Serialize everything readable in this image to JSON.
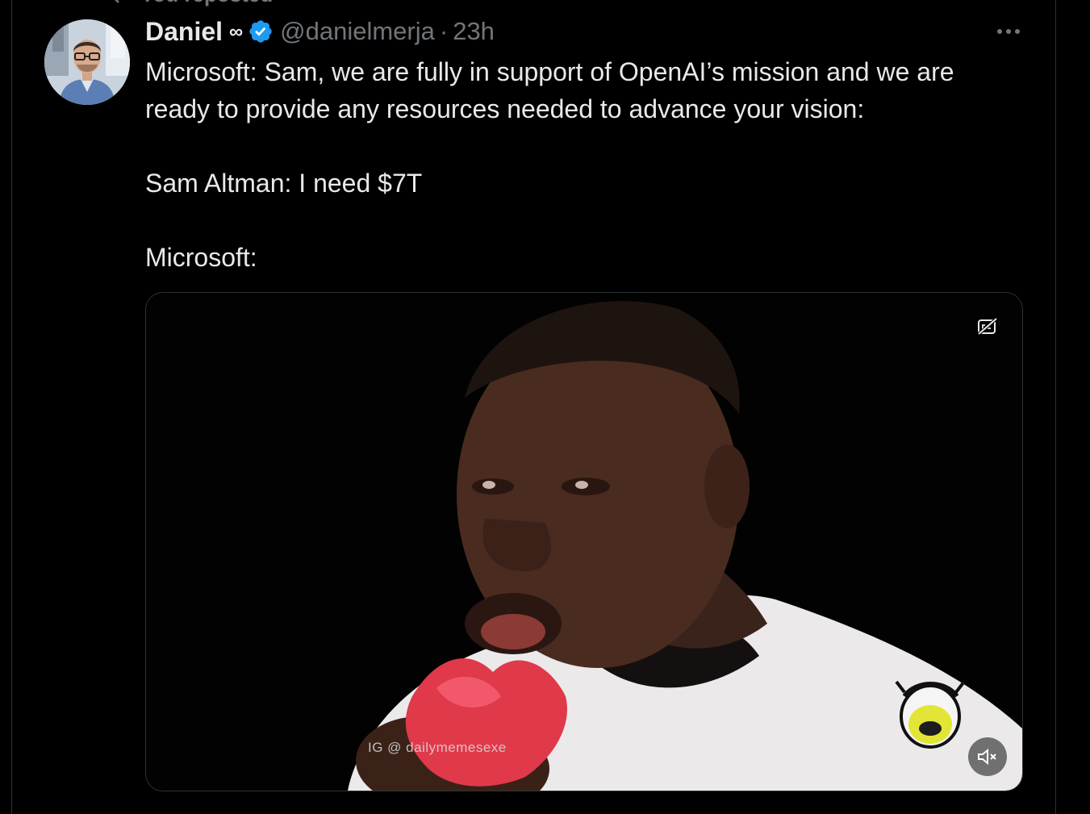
{
  "repost": {
    "label": "You reposted"
  },
  "author": {
    "name": "Daniel",
    "affiliation_icon": "∞",
    "handle": "@danielmerja",
    "separator": "·",
    "time": "23h"
  },
  "tweet": {
    "line1": "Microsoft: Sam, we are fully in support of OpenAI’s mission and we are",
    "line2": "ready to provide any resources needed to advance your vision:",
    "line3": "Sam Altman: I need $7T",
    "line4": "Microsoft:"
  },
  "media": {
    "watermark": "IG @ dailymemesexe"
  },
  "icons": [
    "repost-icon",
    "verified-badge-icon",
    "more-options-icon",
    "closed-captions-icon",
    "mute-icon"
  ],
  "colors": {
    "background": "#000000",
    "text": "#e7e9ea",
    "muted": "#71767b",
    "verified": "#1d9bf0",
    "border": "#2f3336"
  }
}
